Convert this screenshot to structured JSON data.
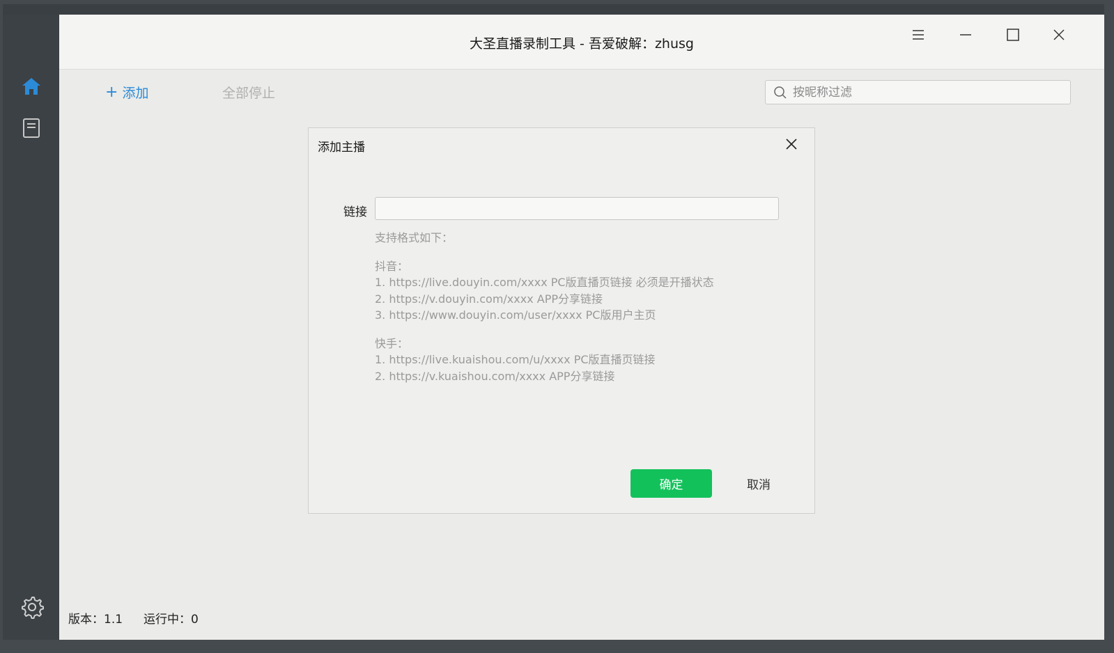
{
  "window": {
    "title": "大圣直播录制工具 - 吾爱破解：zhusg"
  },
  "sidebar": {
    "items": [
      {
        "icon": "home-icon",
        "active": true
      },
      {
        "icon": "document-icon",
        "active": false
      }
    ],
    "settings_icon": "gear-icon"
  },
  "toolbar": {
    "add_label": "添加",
    "stop_all_label": "全部停止",
    "search_placeholder": "按昵称过滤"
  },
  "dialog": {
    "title": "添加主播",
    "link_label": "链接",
    "link_value": "",
    "help_header": "支持格式如下：",
    "groups": [
      {
        "name": "抖音：",
        "lines": [
          "1. https://live.douyin.com/xxxx PC版直播页链接 必须是开播状态",
          "2. https://v.douyin.com/xxxx APP分享链接",
          "3. https://www.douyin.com/user/xxxx PC版用户主页"
        ]
      },
      {
        "name": "快手：",
        "lines": [
          "1. https://live.kuaishou.com/u/xxxx PC版直播页链接",
          "2. https://v.kuaishou.com/xxxx APP分享链接"
        ]
      }
    ],
    "ok_label": "确定",
    "cancel_label": "取消"
  },
  "status": {
    "version": "版本：1.1",
    "running": "运行中：0"
  },
  "colors": {
    "accent": "#2b8bd8",
    "confirm": "#13c15b",
    "sidebar": "#3c4145"
  }
}
